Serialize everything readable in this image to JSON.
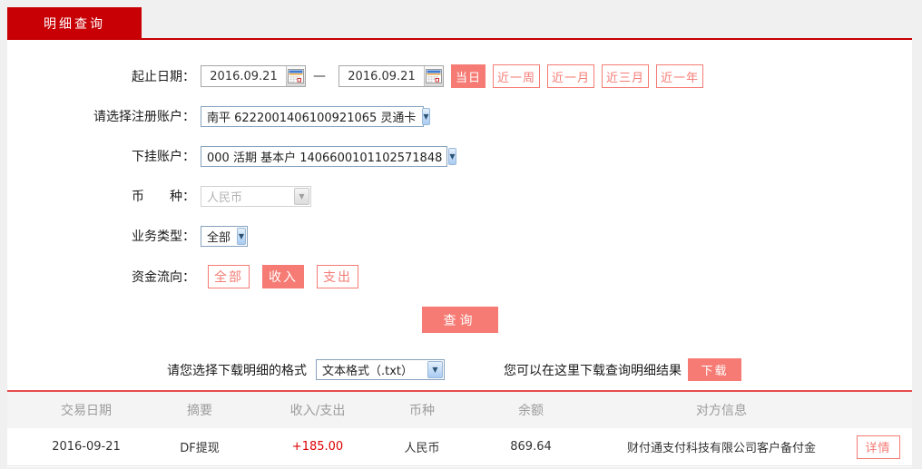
{
  "colors": {
    "brand_red": "#c80005",
    "accent_salmon": "#f57b74",
    "amount_red": "#dd0000",
    "table_top_line": "#e64c4c",
    "page_bg": "#f0f0f0",
    "table_header_bg": "#f4f4f4"
  },
  "tab": {
    "label": "明细查询"
  },
  "form": {
    "date_range": {
      "label": "起止日期：",
      "start": "2016.09.21",
      "end": "2016.09.21",
      "separator": "—",
      "quick_buttons": [
        {
          "label": "当日",
          "active": true
        },
        {
          "label": "近一周",
          "active": false
        },
        {
          "label": "近一月",
          "active": false
        },
        {
          "label": "近三月",
          "active": false
        },
        {
          "label": "近一年",
          "active": false
        }
      ]
    },
    "registered_account": {
      "label": "请选择注册账户：",
      "value": "南平 6222001406100921065 灵通卡"
    },
    "sub_account": {
      "label": "下挂账户：",
      "value": "000 活期 基本户 1406600101102571848"
    },
    "currency": {
      "label": "币　　种：",
      "value": "人民币",
      "disabled": true
    },
    "business_type": {
      "label": "业务类型：",
      "value": "全部"
    },
    "fund_flow": {
      "label": "资金流向：",
      "buttons": [
        {
          "label": "全部",
          "active": false
        },
        {
          "label": "收入",
          "active": true
        },
        {
          "label": "支出",
          "active": false
        }
      ]
    },
    "query_button": "查询"
  },
  "download": {
    "format_label": "请您选择下载明细的格式",
    "format_value": "文本格式（.txt）",
    "hint": "您可以在这里下载查询明细结果",
    "button": "下载"
  },
  "table": {
    "headers": [
      "交易日期",
      "摘要",
      "收入/支出",
      "币种",
      "余额",
      "对方信息"
    ],
    "rows": [
      {
        "date": "2016-09-21",
        "summary": "DF提现",
        "amount": "+185.00",
        "currency": "人民币",
        "balance": "869.64",
        "counterparty": "财付通支付科技有限公司客户备付金",
        "detail_button": "详情"
      }
    ]
  }
}
